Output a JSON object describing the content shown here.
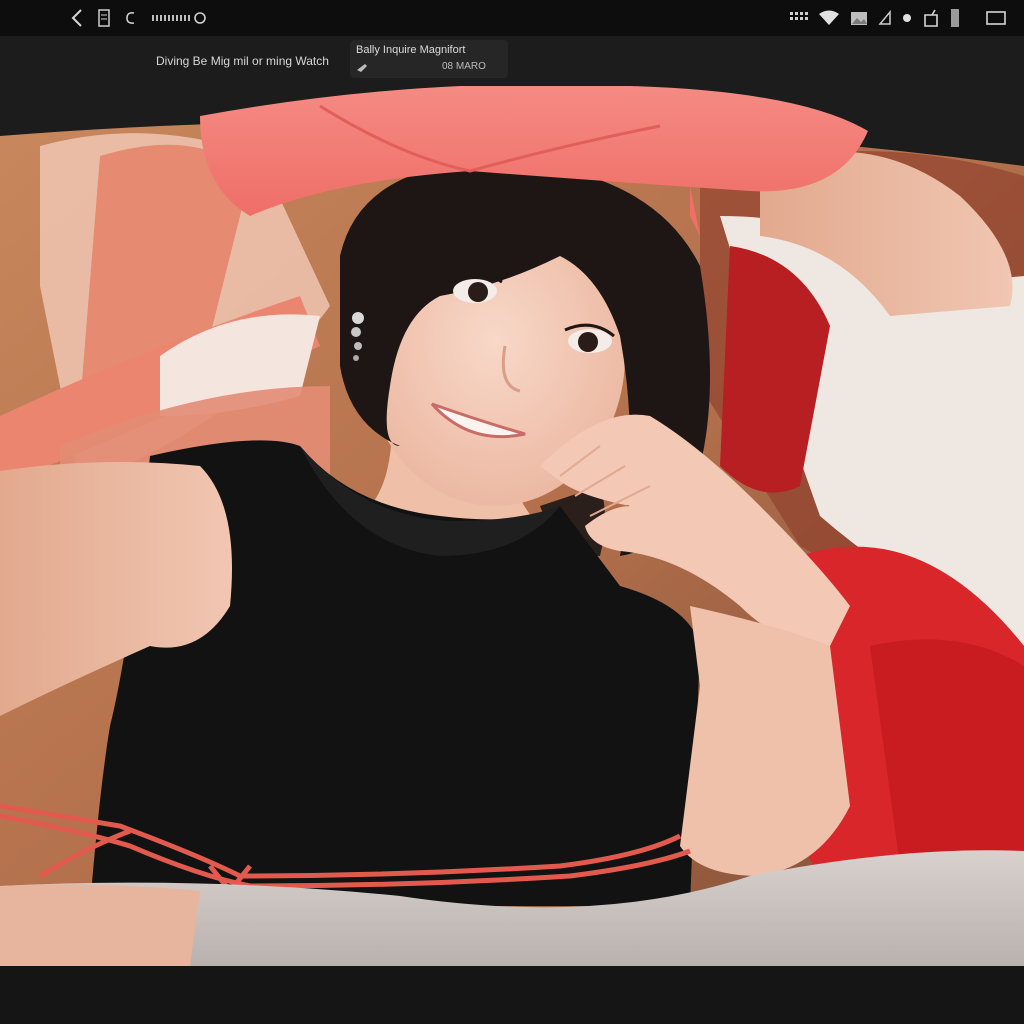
{
  "status_bar": {
    "left_icons": [
      "back-chevron-icon",
      "sim-icon",
      "clock-icon",
      "signal-text-icon"
    ],
    "right_icons": [
      "grid-icon",
      "wifi-icon",
      "image-icon",
      "location-icon",
      "dot-icon",
      "notification-icon",
      "battery-icon",
      "window-icon"
    ]
  },
  "caption": {
    "left_text": "Diving Be Mig mil or ming Watch",
    "box_title": "Bally Inquire Magnifort",
    "box_subtitle": "08 MARO"
  },
  "photo": {
    "subject": "Young woman with short black bob hair and a pink wide-brim hat taking a selfie",
    "colors": {
      "hat": "#f27a74",
      "shirt": "#121212",
      "skin": "#f2c7b4",
      "background_warm": "#d98c68",
      "red_fabric": "#d7282a",
      "white_fabric": "#f1ece7",
      "rope": "#e25a4e",
      "pants": "#cfc7c3"
    }
  }
}
